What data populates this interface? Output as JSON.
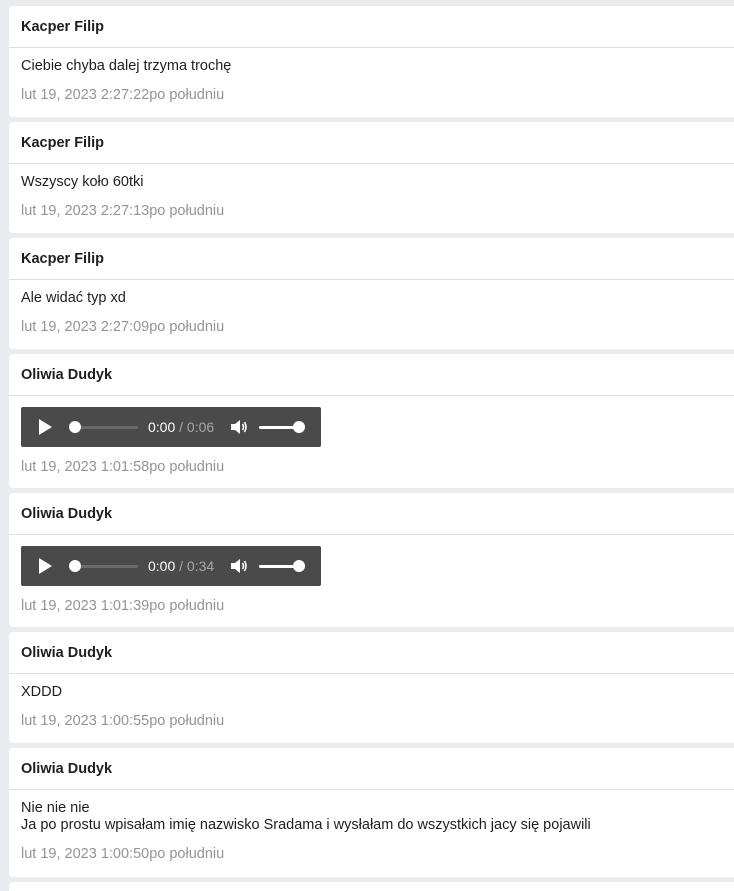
{
  "messages": [
    {
      "sender": "Kacper Filip",
      "text": "Ciebie chyba dalej trzyma trochę",
      "timestamp": "lut 19, 2023 2:27:22po południu"
    },
    {
      "sender": "Kacper Filip",
      "text": "Wszyscy koło 60tki",
      "timestamp": "lut 19, 2023 2:27:13po południu"
    },
    {
      "sender": "Kacper Filip",
      "text": "Ale widać typ xd",
      "timestamp": "lut 19, 2023 2:27:09po południu"
    },
    {
      "sender": "Oliwia Dudyk",
      "audio": {
        "current": "0:00",
        "duration": "/ 0:06",
        "progress": 0,
        "volume": 1.0
      },
      "timestamp": "lut 19, 2023 1:01:58po południu"
    },
    {
      "sender": "Oliwia Dudyk",
      "audio": {
        "current": "0:00",
        "duration": "/ 0:34",
        "progress": 0,
        "volume": 1.0
      },
      "timestamp": "lut 19, 2023 1:01:39po południu"
    },
    {
      "sender": "Oliwia Dudyk",
      "text": "XDDD",
      "timestamp": "lut 19, 2023 1:00:55po południu"
    },
    {
      "sender": "Oliwia Dudyk",
      "text": "Nie nie nie\nJa po prostu wpisałam imię nazwisko Sradama i wysłałam do wszystkich jacy się pojawili",
      "timestamp": "lut 19, 2023 1:00:50po południu"
    }
  ],
  "icons": {
    "play": "play-icon",
    "volume": "volume-icon"
  }
}
